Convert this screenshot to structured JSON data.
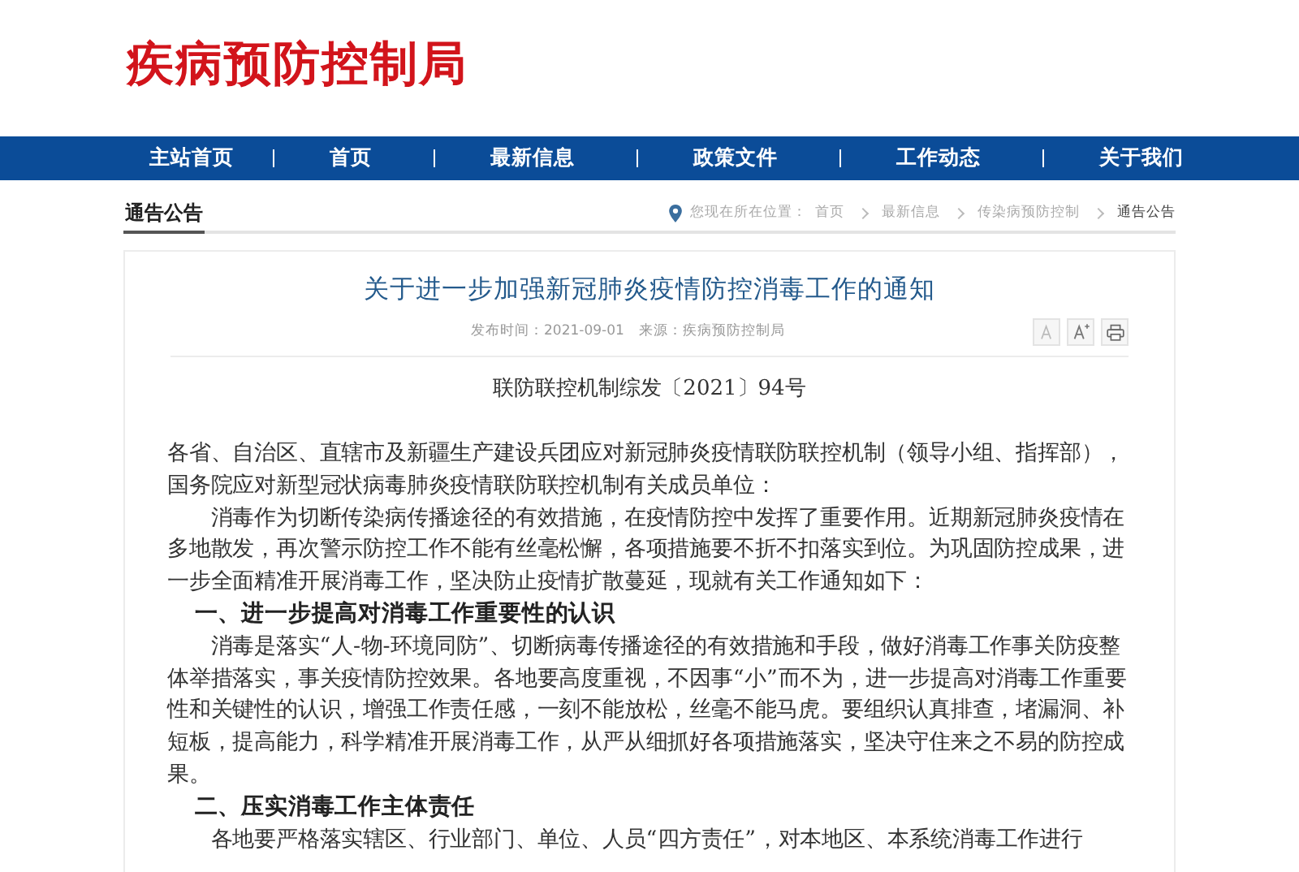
{
  "site_title": "疾病预防控制局",
  "nav": [
    {
      "label": "主站首页"
    },
    {
      "label": "首页"
    },
    {
      "label": "最新信息"
    },
    {
      "label": "政策文件"
    },
    {
      "label": "工作动态"
    },
    {
      "label": "关于我们"
    }
  ],
  "section_title": "通告公告",
  "breadcrumb": {
    "prefix": "您现在所在位置：",
    "items": [
      "首页",
      "最新信息",
      "传染病预防控制",
      "通告公告"
    ]
  },
  "article": {
    "title": "关于进一步加强新冠肺炎疫情防控消毒工作的通知",
    "meta": "发布时间：2021-09-01　来源：疾病预防控制局",
    "tools": [
      {
        "kind": "font-smaller"
      },
      {
        "kind": "font-larger"
      },
      {
        "kind": "print"
      }
    ],
    "doc_number": "联防联控机制综发〔2021〕94号",
    "blocks": [
      {
        "kind": "address",
        "text": "各省、自治区、直辖市及新疆生产建设兵团应对新冠肺炎疫情联防联控机制（领导小组、指挥部），国务院应对新型冠状病毒肺炎疫情联防联控机制有关成员单位："
      },
      {
        "kind": "paragraph",
        "text": "消毒作为切断传染病传播途径的有效措施，在疫情防控中发挥了重要作用。近期新冠肺炎疫情在多地散发，再次警示防控工作不能有丝毫松懈，各项措施要不折不扣落实到位。为巩固防控成果，进一步全面精准开展消毒工作，坚决防止疫情扩散蔓延，现就有关工作通知如下："
      },
      {
        "kind": "heading",
        "text": "一、进一步提高对消毒工作重要性的认识"
      },
      {
        "kind": "paragraph",
        "text": "消毒是落实“人-物-环境同防”、切断病毒传播途径的有效措施和手段，做好消毒工作事关防疫整体举措落实，事关疫情防控效果。各地要高度重视，不因事“小”而不为，进一步提高对消毒工作重要性和关键性的认识，增强工作责任感，一刻不能放松，丝毫不能马虎。要组织认真排查，堵漏洞、补短板，提高能力，科学精准开展消毒工作，从严从细抓好各项措施落实，坚决守住来之不易的防控成果。"
      },
      {
        "kind": "heading",
        "text": "二、压实消毒工作主体责任"
      },
      {
        "kind": "paragraph",
        "text": "各地要严格落实辖区、行业部门、单位、人员“四方责任”，对本地区、本系统消毒工作进行"
      }
    ]
  }
}
